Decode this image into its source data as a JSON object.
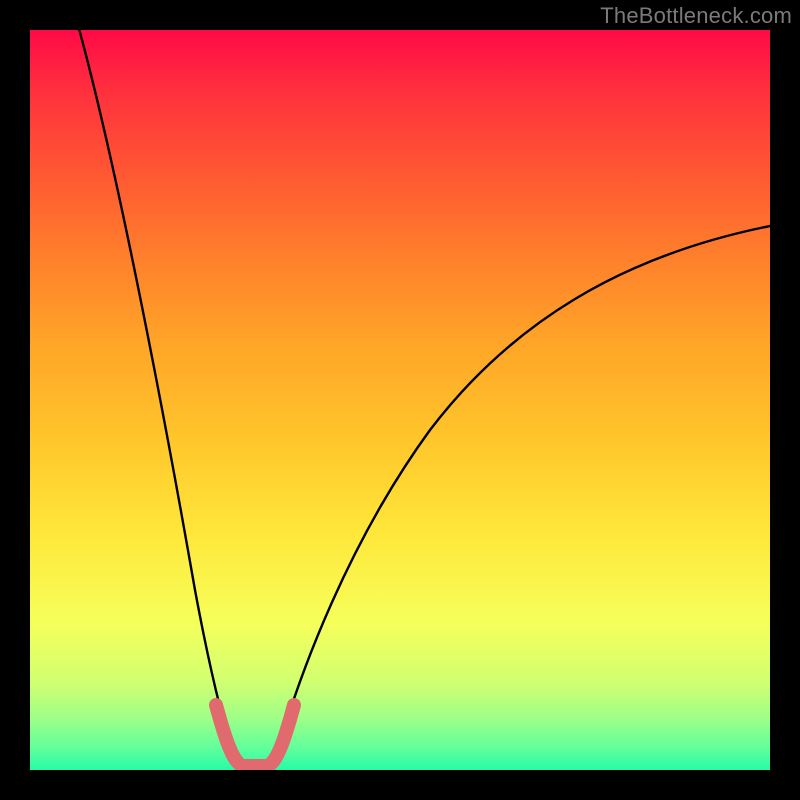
{
  "watermark": "TheBottleneck.com",
  "chart_data": {
    "type": "line",
    "title": "",
    "xlabel": "",
    "ylabel": "",
    "xlim": [
      0,
      100
    ],
    "ylim": [
      0,
      100
    ],
    "grid": false,
    "legend": false,
    "background": "red-yellow-green vertical gradient",
    "series": [
      {
        "name": "left-branch-black",
        "color": "#000000",
        "x": [
          7,
          10,
          13,
          16,
          19,
          21,
          23,
          25,
          27
        ],
        "y": [
          100,
          85,
          68,
          52,
          36,
          24,
          14,
          7,
          2
        ]
      },
      {
        "name": "valley-pink-thick",
        "color": "#e06a6e",
        "x": [
          25,
          26,
          27,
          28,
          29,
          30,
          31,
          32,
          33,
          34,
          35
        ],
        "y": [
          8,
          4,
          1,
          0,
          0,
          0,
          0,
          0,
          1,
          4,
          8
        ]
      },
      {
        "name": "right-branch-black",
        "color": "#000000",
        "x": [
          33,
          36,
          40,
          45,
          50,
          56,
          63,
          71,
          80,
          90,
          100
        ],
        "y": [
          2,
          8,
          16,
          25,
          33,
          41,
          49,
          56,
          62,
          67,
          71
        ]
      }
    ],
    "annotations": [],
    "notes": "Axes are unlabeled; values are relative estimates from pixel positions on a 0–100 normalized scale. Valley minimum (0) occurs around x≈28–32."
  }
}
